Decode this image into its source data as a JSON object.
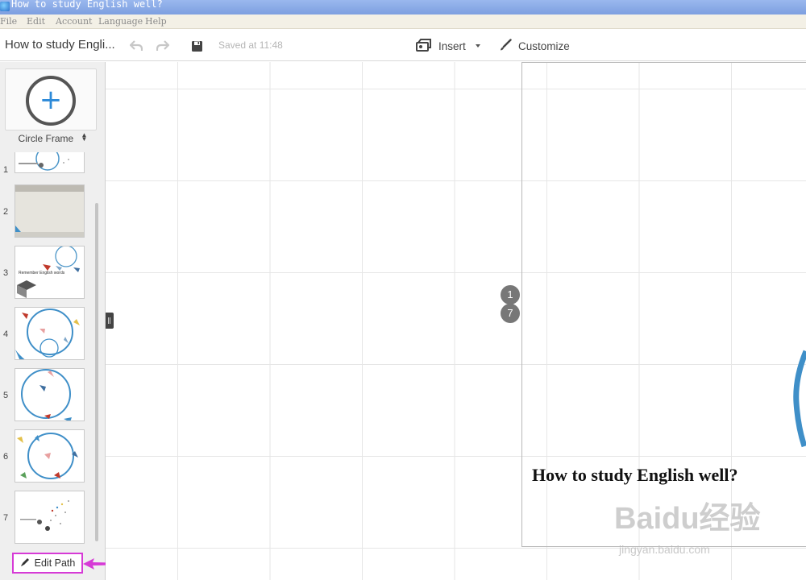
{
  "window": {
    "title": "How to study English well?"
  },
  "menubar": {
    "items": [
      "File",
      "Edit",
      "Account",
      "Language",
      "Help"
    ]
  },
  "toolbar": {
    "doc_title": "How to study Engli...",
    "saved_text": "Saved at 11:48",
    "insert_label": "Insert",
    "customize_label": "Customize"
  },
  "sidebar": {
    "frame_type": "Circle Frame",
    "slides": [
      {
        "number": "1"
      },
      {
        "number": "2"
      },
      {
        "number": "3",
        "thumb_text": "Remember English words"
      },
      {
        "number": "4"
      },
      {
        "number": "5"
      },
      {
        "number": "6"
      },
      {
        "number": "7"
      }
    ],
    "edit_path_label": "Edit Path"
  },
  "canvas": {
    "path_markers": [
      "1",
      "7"
    ],
    "presentation_title": "How to study English well?"
  },
  "watermark": {
    "brand": "Baidu经验",
    "url": "jingyan.baidu.com"
  },
  "colors": {
    "accent_blue": "#2d8ad8",
    "highlight_magenta": "#d63ad6",
    "ring_blue": "#3f8fc8"
  }
}
